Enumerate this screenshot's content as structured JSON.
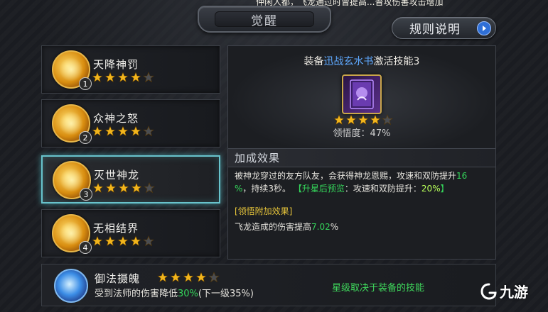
{
  "top_strip": "仲闲人都，飞龙通过时曾提高...普攻伤害攻击增加",
  "header": {
    "title": "觉醒"
  },
  "rules_button": {
    "label": "规则说明"
  },
  "skills": [
    {
      "name": "天降神罚",
      "number": "1",
      "stars": 4,
      "max_stars": 5,
      "selected": false
    },
    {
      "name": "众神之怒",
      "number": "2",
      "stars": 4,
      "max_stars": 5,
      "selected": false
    },
    {
      "name": "灭世神龙",
      "number": "3",
      "stars": 4,
      "max_stars": 5,
      "selected": true
    },
    {
      "name": "无相结界",
      "number": "4",
      "stars": 4,
      "max_stars": 5,
      "selected": false
    }
  ],
  "equip": {
    "prefix": "装备",
    "name": "迅战玄水书",
    "suffix": "激活技能3",
    "stars": 4,
    "max_stars": 5,
    "comprehension_label": "领悟度：47%"
  },
  "bonus": {
    "title": "加成效果",
    "line1_pre": "被神龙穿过的友方队友，会获得神龙恩赐，攻速和双防提升",
    "line1_val": "16",
    "line2_val": "%",
    "line2_post": "，持续3秒。",
    "preview_pre": "【",
    "preview_label": "升星后预览",
    "preview_mid": "：攻速和双防提升：",
    "preview_val": "20%",
    "preview_end": "】",
    "extra_title": "[领悟附加效果]",
    "extra_pre": "飞龙造成的伤害提高",
    "extra_val": "7.02",
    "extra_post": "%"
  },
  "bottom": {
    "name": "御法摄魄",
    "stars": 4,
    "max_stars": 5,
    "desc_pre": "受到法师的伤害降低",
    "desc_val": "30%",
    "desc_post": "(下一级35%)",
    "note": "星级取决于装备的技能"
  },
  "watermark": {
    "text": "九游"
  },
  "colors": {
    "star_gold": "#f2b51c",
    "star_empty": "#4a4d52",
    "selected_border": "#68c3cc",
    "green": "#34d45a",
    "equip_blue": "#5fa9ff",
    "extra_gold": "#e6c43a"
  }
}
